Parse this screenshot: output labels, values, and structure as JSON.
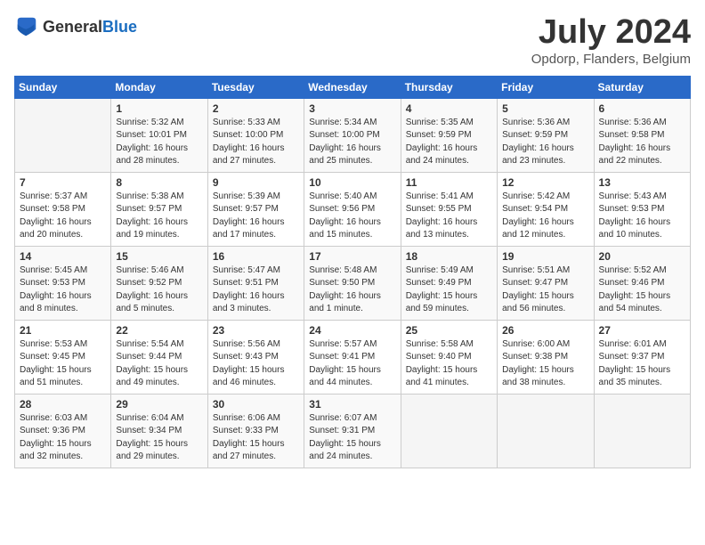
{
  "logo": {
    "general": "General",
    "blue": "Blue"
  },
  "title": "July 2024",
  "location": "Opdorp, Flanders, Belgium",
  "days_of_week": [
    "Sunday",
    "Monday",
    "Tuesday",
    "Wednesday",
    "Thursday",
    "Friday",
    "Saturday"
  ],
  "weeks": [
    [
      {
        "day": "",
        "info": ""
      },
      {
        "day": "1",
        "info": "Sunrise: 5:32 AM\nSunset: 10:01 PM\nDaylight: 16 hours\nand 28 minutes."
      },
      {
        "day": "2",
        "info": "Sunrise: 5:33 AM\nSunset: 10:00 PM\nDaylight: 16 hours\nand 27 minutes."
      },
      {
        "day": "3",
        "info": "Sunrise: 5:34 AM\nSunset: 10:00 PM\nDaylight: 16 hours\nand 25 minutes."
      },
      {
        "day": "4",
        "info": "Sunrise: 5:35 AM\nSunset: 9:59 PM\nDaylight: 16 hours\nand 24 minutes."
      },
      {
        "day": "5",
        "info": "Sunrise: 5:36 AM\nSunset: 9:59 PM\nDaylight: 16 hours\nand 23 minutes."
      },
      {
        "day": "6",
        "info": "Sunrise: 5:36 AM\nSunset: 9:58 PM\nDaylight: 16 hours\nand 22 minutes."
      }
    ],
    [
      {
        "day": "7",
        "info": "Sunrise: 5:37 AM\nSunset: 9:58 PM\nDaylight: 16 hours\nand 20 minutes."
      },
      {
        "day": "8",
        "info": "Sunrise: 5:38 AM\nSunset: 9:57 PM\nDaylight: 16 hours\nand 19 minutes."
      },
      {
        "day": "9",
        "info": "Sunrise: 5:39 AM\nSunset: 9:57 PM\nDaylight: 16 hours\nand 17 minutes."
      },
      {
        "day": "10",
        "info": "Sunrise: 5:40 AM\nSunset: 9:56 PM\nDaylight: 16 hours\nand 15 minutes."
      },
      {
        "day": "11",
        "info": "Sunrise: 5:41 AM\nSunset: 9:55 PM\nDaylight: 16 hours\nand 13 minutes."
      },
      {
        "day": "12",
        "info": "Sunrise: 5:42 AM\nSunset: 9:54 PM\nDaylight: 16 hours\nand 12 minutes."
      },
      {
        "day": "13",
        "info": "Sunrise: 5:43 AM\nSunset: 9:53 PM\nDaylight: 16 hours\nand 10 minutes."
      }
    ],
    [
      {
        "day": "14",
        "info": "Sunrise: 5:45 AM\nSunset: 9:53 PM\nDaylight: 16 hours\nand 8 minutes."
      },
      {
        "day": "15",
        "info": "Sunrise: 5:46 AM\nSunset: 9:52 PM\nDaylight: 16 hours\nand 5 minutes."
      },
      {
        "day": "16",
        "info": "Sunrise: 5:47 AM\nSunset: 9:51 PM\nDaylight: 16 hours\nand 3 minutes."
      },
      {
        "day": "17",
        "info": "Sunrise: 5:48 AM\nSunset: 9:50 PM\nDaylight: 16 hours\nand 1 minute."
      },
      {
        "day": "18",
        "info": "Sunrise: 5:49 AM\nSunset: 9:49 PM\nDaylight: 15 hours\nand 59 minutes."
      },
      {
        "day": "19",
        "info": "Sunrise: 5:51 AM\nSunset: 9:47 PM\nDaylight: 15 hours\nand 56 minutes."
      },
      {
        "day": "20",
        "info": "Sunrise: 5:52 AM\nSunset: 9:46 PM\nDaylight: 15 hours\nand 54 minutes."
      }
    ],
    [
      {
        "day": "21",
        "info": "Sunrise: 5:53 AM\nSunset: 9:45 PM\nDaylight: 15 hours\nand 51 minutes."
      },
      {
        "day": "22",
        "info": "Sunrise: 5:54 AM\nSunset: 9:44 PM\nDaylight: 15 hours\nand 49 minutes."
      },
      {
        "day": "23",
        "info": "Sunrise: 5:56 AM\nSunset: 9:43 PM\nDaylight: 15 hours\nand 46 minutes."
      },
      {
        "day": "24",
        "info": "Sunrise: 5:57 AM\nSunset: 9:41 PM\nDaylight: 15 hours\nand 44 minutes."
      },
      {
        "day": "25",
        "info": "Sunrise: 5:58 AM\nSunset: 9:40 PM\nDaylight: 15 hours\nand 41 minutes."
      },
      {
        "day": "26",
        "info": "Sunrise: 6:00 AM\nSunset: 9:38 PM\nDaylight: 15 hours\nand 38 minutes."
      },
      {
        "day": "27",
        "info": "Sunrise: 6:01 AM\nSunset: 9:37 PM\nDaylight: 15 hours\nand 35 minutes."
      }
    ],
    [
      {
        "day": "28",
        "info": "Sunrise: 6:03 AM\nSunset: 9:36 PM\nDaylight: 15 hours\nand 32 minutes."
      },
      {
        "day": "29",
        "info": "Sunrise: 6:04 AM\nSunset: 9:34 PM\nDaylight: 15 hours\nand 29 minutes."
      },
      {
        "day": "30",
        "info": "Sunrise: 6:06 AM\nSunset: 9:33 PM\nDaylight: 15 hours\nand 27 minutes."
      },
      {
        "day": "31",
        "info": "Sunrise: 6:07 AM\nSunset: 9:31 PM\nDaylight: 15 hours\nand 24 minutes."
      },
      {
        "day": "",
        "info": ""
      },
      {
        "day": "",
        "info": ""
      },
      {
        "day": "",
        "info": ""
      }
    ]
  ]
}
